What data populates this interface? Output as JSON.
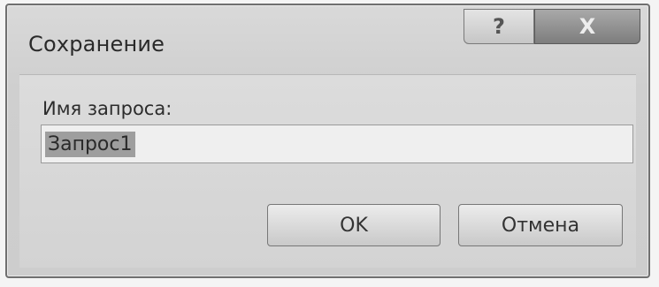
{
  "dialog": {
    "title": "Сохранение",
    "help_glyph": "?",
    "close_glyph": "X",
    "field_label": "Имя запроса:",
    "field_value": "Запрос1",
    "ok_label": "OK",
    "cancel_label": "Отмена"
  }
}
